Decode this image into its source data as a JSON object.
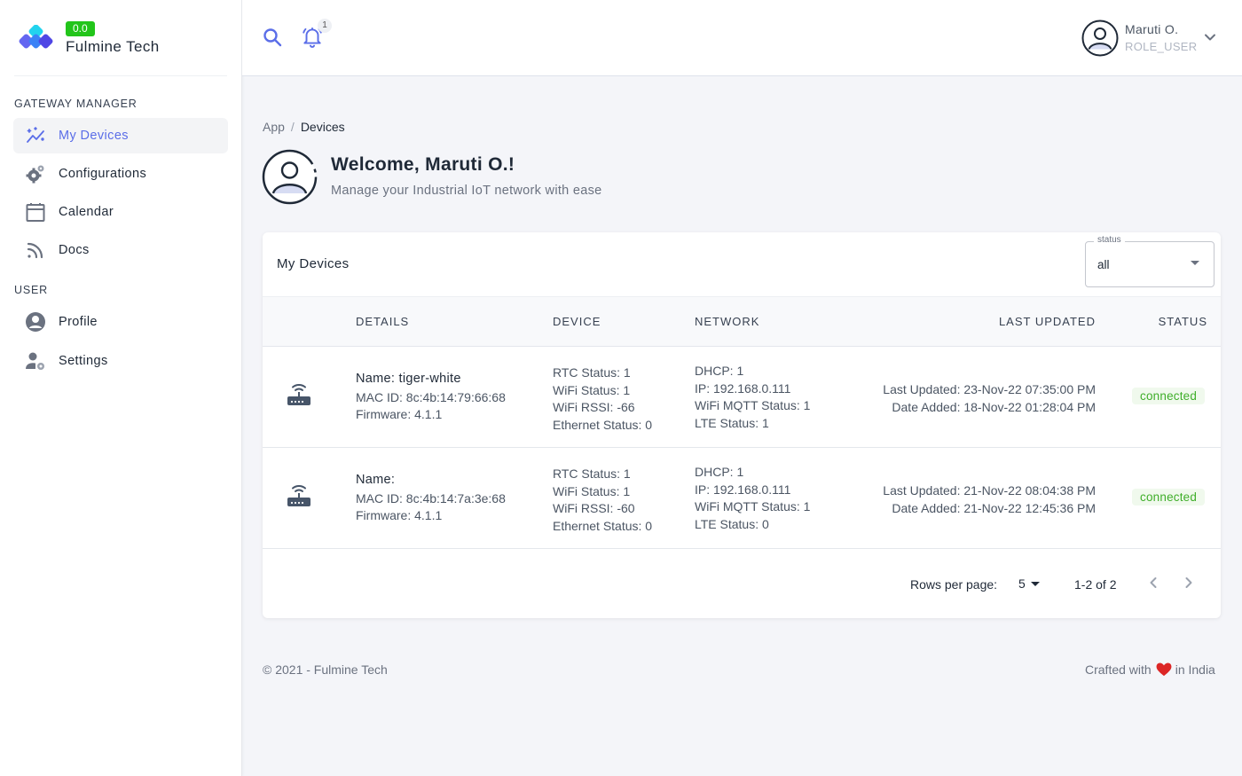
{
  "brand": {
    "name": "Fulmine Tech",
    "version_badge": "0.0"
  },
  "sidebar": {
    "sections": [
      {
        "title": "GATEWAY MANAGER"
      },
      {
        "title": "USER"
      }
    ],
    "items": [
      {
        "label": "My Devices",
        "icon": "devices-icon",
        "active": true
      },
      {
        "label": "Configurations",
        "icon": "gear-icon"
      },
      {
        "label": "Calendar",
        "icon": "calendar-icon"
      },
      {
        "label": "Docs",
        "icon": "rss-icon"
      },
      {
        "label": "Profile",
        "icon": "user-circle-icon"
      },
      {
        "label": "Settings",
        "icon": "user-settings-icon"
      }
    ]
  },
  "topbar": {
    "notification_count": "1",
    "user_name": "Maruti O.",
    "user_role": "ROLE_USER"
  },
  "breadcrumb": {
    "root": "App",
    "separator": "/",
    "current": "Devices"
  },
  "welcome": {
    "title": "Welcome, Maruti O.!",
    "subtitle": "Manage your Industrial IoT network with ease"
  },
  "card": {
    "title": "My Devices",
    "status_filter": {
      "legend": "status",
      "value": "all"
    },
    "columns": [
      "DETAILS",
      "DEVICE",
      "NETWORK",
      "LAST UPDATED",
      "STATUS"
    ],
    "rows": [
      {
        "name": "Name: tiger-white",
        "mac": "MAC ID: 8c:4b:14:79:66:68",
        "firmware": "Firmware: 4.1.1",
        "rtc": "RTC Status: 1",
        "wifi": "WiFi Status: 1",
        "rssi": "WiFi RSSI: -66",
        "ethernet": "Ethernet Status: 0",
        "dhcp": "DHCP: 1",
        "ip": "IP: 192.168.0.111",
        "mqtt": "WiFi MQTT Status: 1",
        "lte": "LTE Status: 1",
        "last_updated": "Last Updated: 23-Nov-22 07:35:00 PM",
        "date_added": "Date Added: 18-Nov-22 01:28:04 PM",
        "status": "connected"
      },
      {
        "name": "Name:",
        "mac": "MAC ID: 8c:4b:14:7a:3e:68",
        "firmware": "Firmware: 4.1.1",
        "rtc": "RTC Status: 1",
        "wifi": "WiFi Status: 1",
        "rssi": "WiFi RSSI: -60",
        "ethernet": "Ethernet Status: 0",
        "dhcp": "DHCP: 1",
        "ip": "IP: 192.168.0.111",
        "mqtt": "WiFi MQTT Status: 1",
        "lte": "LTE Status: 0",
        "last_updated": "Last Updated: 21-Nov-22 08:04:38 PM",
        "date_added": "Date Added: 21-Nov-22 12:45:36 PM",
        "status": "connected"
      }
    ],
    "pagination": {
      "rows_per_page_label": "Rows per page:",
      "rows_per_page": "5",
      "range": "1-2 of 2"
    }
  },
  "footer": {
    "copyright": "© 2021 - Fulmine Tech",
    "crafted_prefix": "Crafted with",
    "crafted_suffix": "in India"
  },
  "colors": {
    "accent": "#5b6ee8",
    "badge_green": "#22c51a",
    "status_connected": "#3fae2a",
    "heart": "#dc2626"
  }
}
